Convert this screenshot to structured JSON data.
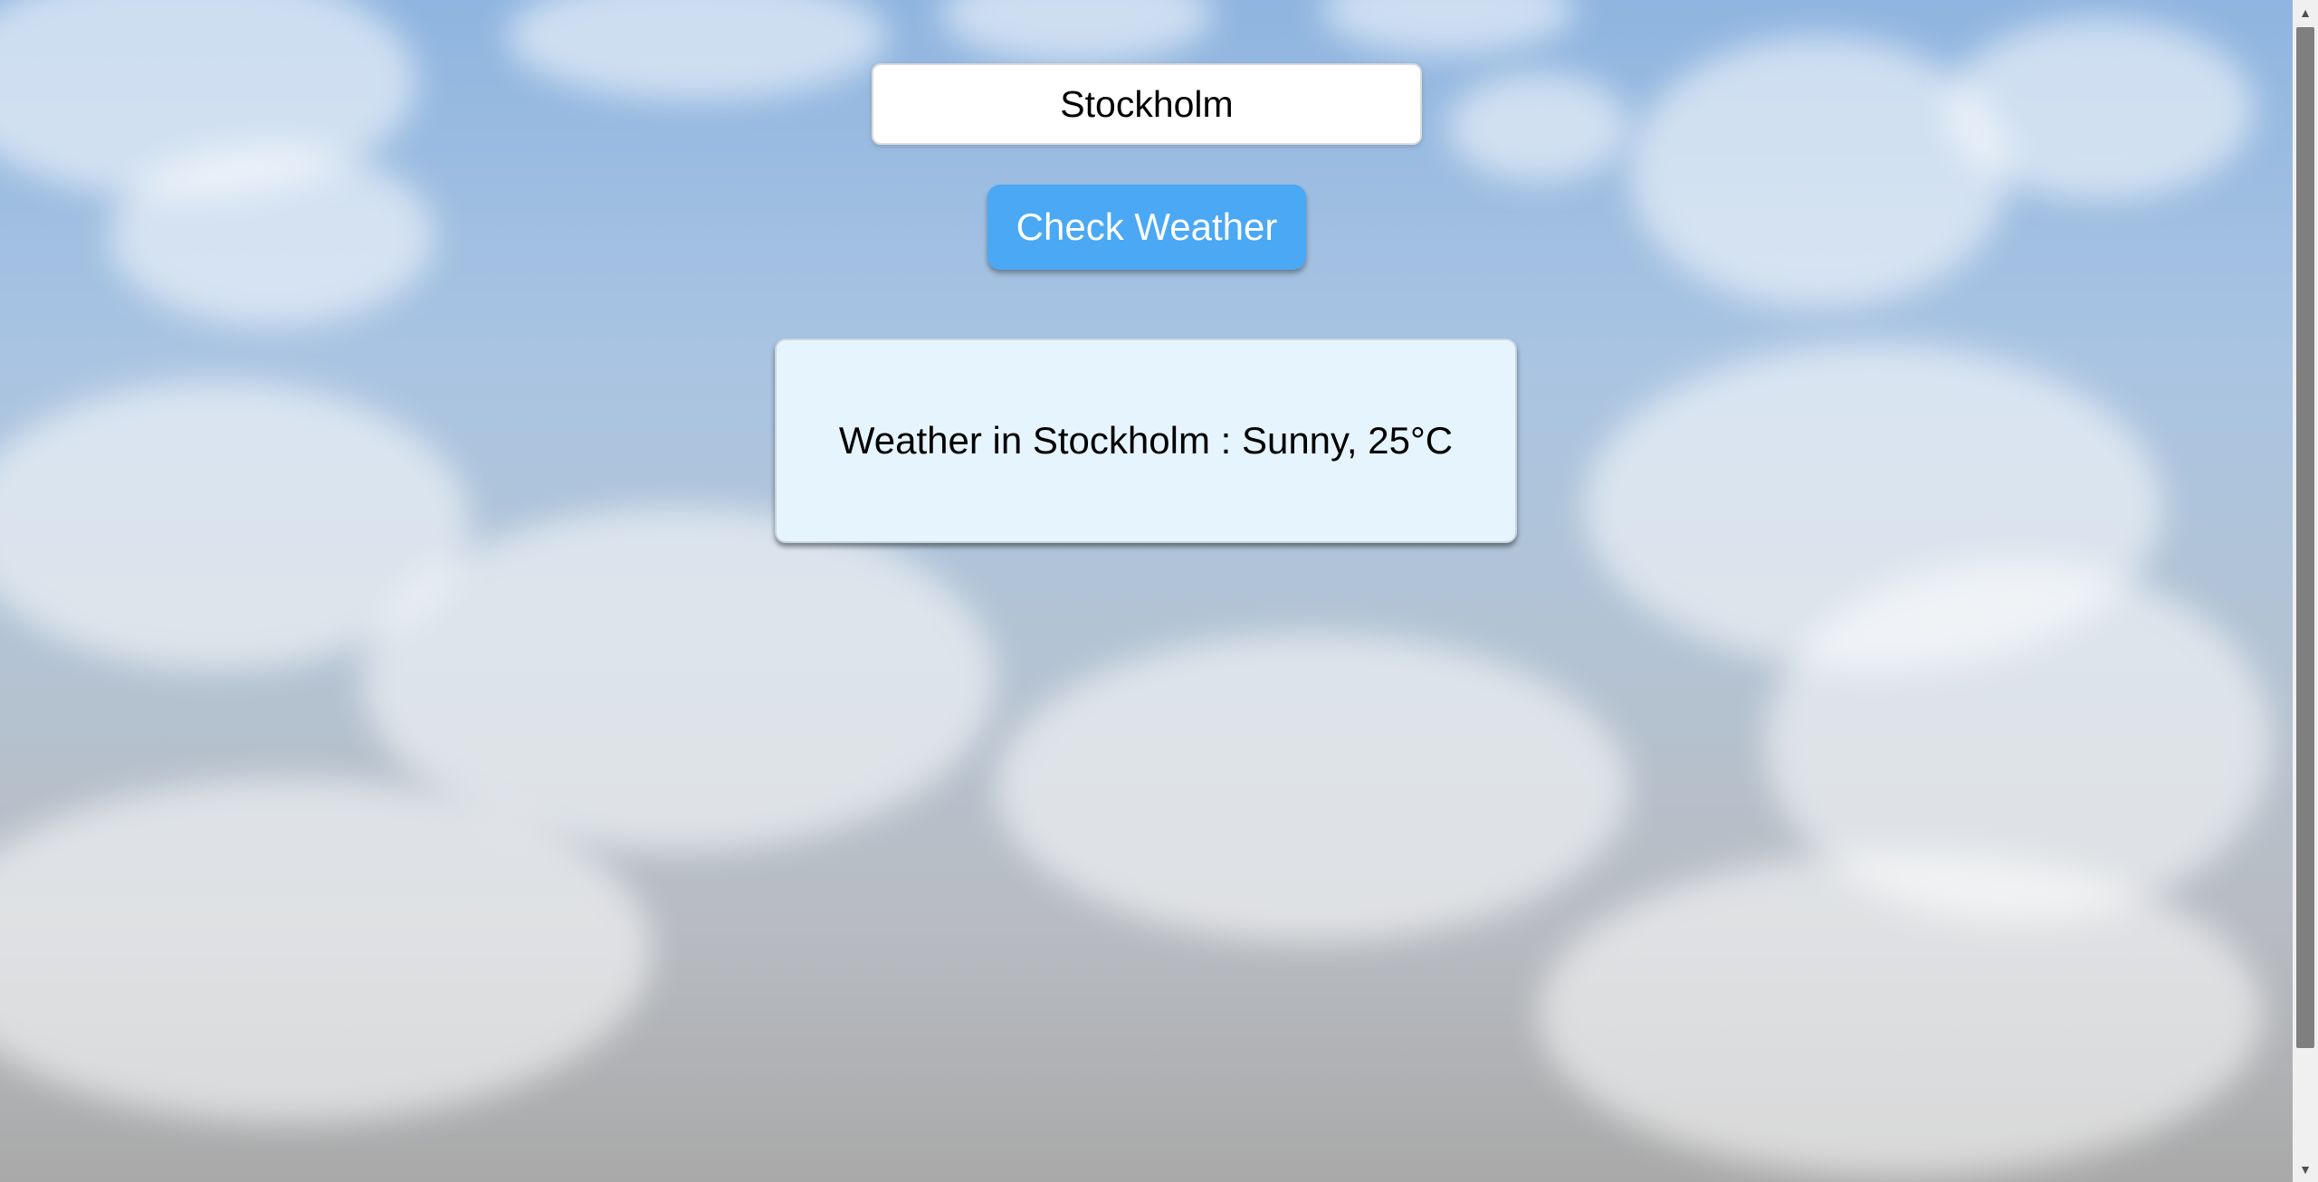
{
  "search": {
    "value": "Stockholm",
    "placeholder": ""
  },
  "actions": {
    "check_label": "Check Weather"
  },
  "result": {
    "text": "Weather in Stockholm : Sunny, 25°C"
  },
  "scrollbar": {
    "up_icon": "▲",
    "down_icon": "▼"
  },
  "colors": {
    "button": "#4aa8f4",
    "card": "#e6f4fd"
  }
}
